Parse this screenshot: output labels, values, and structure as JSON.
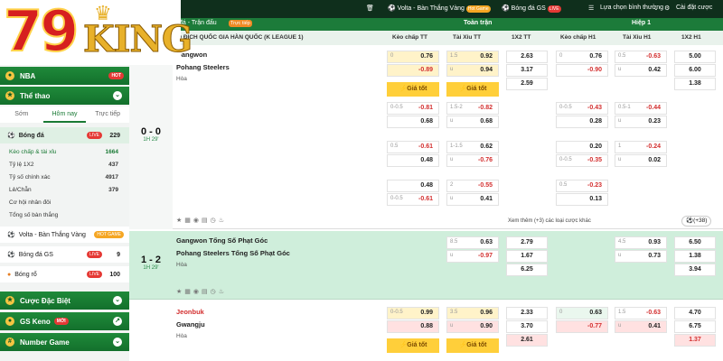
{
  "brand": {
    "n": "79",
    "king": "KING"
  },
  "sidebar": {
    "nba": "NBA",
    "nba_hot": "HOT",
    "sports": "Thể thao",
    "tabs": [
      "Sớm",
      "Hôm nay",
      "Trực tiếp"
    ],
    "football": "Bóng đá",
    "football_badge": "LIVE",
    "football_n": "229",
    "subs": [
      {
        "l": "Kèo chấp & tài xỉu",
        "n": "1664"
      },
      {
        "l": "Tỷ lệ 1X2",
        "n": "437"
      },
      {
        "l": "Tỷ số chính xác",
        "n": "4917"
      },
      {
        "l": "Lẻ/Chẵn",
        "n": "379"
      },
      {
        "l": "Cơ hội nhân đôi",
        "n": ""
      },
      {
        "l": "Tổng số bàn thắng",
        "n": ""
      }
    ],
    "volta": "Volta - Bàn Thắng Vàng",
    "volta_badge": "HOT GAME",
    "gs": "Bóng đá GS",
    "gs_badge": "LIVE",
    "gs_n": "9",
    "basket": "Bóng rổ",
    "basket_badge": "LIVE",
    "basket_n": "100",
    "special": "Cược Đặc Biệt",
    "keno": "GS Keno",
    "keno_badge": "MỚI",
    "number": "Number Game"
  },
  "topbar": {
    "volta": "Volta - Bàn Thắng Vàng",
    "volta_badge": "Hot Game",
    "gs": "Bóng đá GS",
    "gs_badge": "LIVE",
    "select": "Lựa chọn bình thường",
    "settings": "Cài đặt cược"
  },
  "header": {
    "left": "đá - Trận đấu",
    "left_badge": "Trực tiếp",
    "full": "Toàn trận",
    "half": "Hiệp 1",
    "league": "Ô ĐỊCH QUỐC GIA HÀN QUỐC (K LEAGUE 1)",
    "cols": [
      "Kèo chấp TT",
      "Tài Xỉu TT",
      "1X2 TT",
      "Kèo chấp H1",
      "Tài Xỉu H1",
      "1X2 H1"
    ]
  },
  "good_price": "Giá tốt",
  "match1": {
    "score": "0 - 0",
    "time": "1H 29'",
    "home": "Gangwon",
    "away": "Pohang Steelers",
    "draw": "Hòa",
    "more": "Xem thêm (+3) các loại cược khác",
    "more_n": "(+38)",
    "rows": [
      {
        "ah": [
          "0",
          "0.76"
        ],
        "ah2": [
          "",
          "-0.89"
        ],
        "ou": [
          "1.5",
          "0.92"
        ],
        "ou2": [
          "u",
          "0.94"
        ],
        "x": [
          "2.63",
          "3.17",
          "2.59"
        ],
        "h1ah": [
          "0",
          "0.76"
        ],
        "h1ah2": [
          "",
          "-0.90"
        ],
        "h1ou": [
          "0.5",
          "-0.63"
        ],
        "h1ou2": [
          "u",
          "0.42"
        ],
        "h1x": [
          "5.00",
          "6.00",
          "1.38"
        ]
      },
      {
        "ah": [
          "0-0.5",
          "-0.81"
        ],
        "ah2": [
          "",
          "0.68"
        ],
        "ou": [
          "1.5-2",
          "-0.82"
        ],
        "ou2": [
          "u",
          "0.68"
        ],
        "h1ah": [
          "0-0.5",
          "-0.43"
        ],
        "h1ah2": [
          "",
          "0.28"
        ],
        "h1ou": [
          "0.5-1",
          "-0.44"
        ],
        "h1ou2": [
          "u",
          "0.23"
        ]
      },
      {
        "ah": [
          "0.5",
          "-0.61"
        ],
        "ah2": [
          "",
          "0.48"
        ],
        "ou": [
          "1-1.5",
          "0.62"
        ],
        "ou2": [
          "u",
          "-0.76"
        ],
        "h1ah": [
          "",
          "0.20"
        ],
        "h1ah2": [
          "0-0.5",
          "-0.35"
        ],
        "h1ou": [
          "1",
          "-0.24"
        ],
        "h1ou2": [
          "u",
          "0.02"
        ]
      },
      {
        "ah": [
          "",
          "0.48"
        ],
        "ah2": [
          "0-0.5",
          "-0.61"
        ],
        "ou": [
          "2",
          "-0.55"
        ],
        "ou2": [
          "u",
          "0.41"
        ],
        "h1ah": [
          "0.5",
          "-0.23"
        ],
        "h1ah2": [
          "",
          "0.13"
        ]
      }
    ]
  },
  "match2": {
    "score": "1 - 2",
    "time": "1H 29'",
    "home": "Gangwon Tổng Số Phạt Góc",
    "away": "Pohang Steelers Tổng Số Phạt Góc",
    "draw": "Hòa",
    "ou": [
      "8.5",
      "0.63"
    ],
    "ou2": [
      "u",
      "-0.97"
    ],
    "x": [
      "2.79",
      "1.67",
      "6.25"
    ],
    "h1ou": [
      "4.5",
      "0.93"
    ],
    "h1ou2": [
      "u",
      "0.73"
    ],
    "h1x": [
      "6.50",
      "1.38",
      "3.94"
    ]
  },
  "match3": {
    "home": "Jeonbuk",
    "away": "Gwangju",
    "draw": "Hòa",
    "ah": [
      "0-0.5",
      "0.99"
    ],
    "ah2": [
      "",
      "0.88"
    ],
    "ou": [
      "3.5",
      "0.96"
    ],
    "ou2": [
      "u",
      "0.90"
    ],
    "x": [
      "2.33",
      "3.70",
      "2.61"
    ],
    "h1ah": [
      "0",
      "0.63"
    ],
    "h1ah2": [
      "",
      "-0.77"
    ],
    "h1ou": [
      "1.5",
      "-0.63"
    ],
    "h1ou2": [
      "u",
      "0.41"
    ],
    "h1x": [
      "4.70",
      "6.75",
      "1.37"
    ]
  },
  "colors": {
    "brand_green": "#1c7b3a",
    "topbar": "#0f2f1c",
    "gold": "#ffcf3a",
    "red": "#d32f2f"
  }
}
